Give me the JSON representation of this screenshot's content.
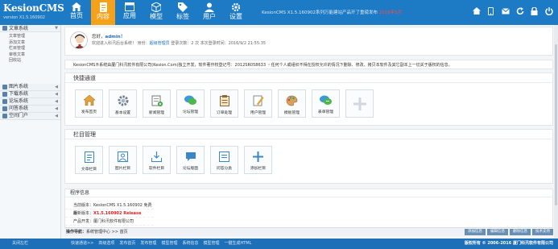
{
  "brand": {
    "name": "KesionCMS",
    "version": "version X1.5.160902"
  },
  "nav": [
    {
      "label": "首页",
      "icon": "home-icon"
    },
    {
      "label": "内容",
      "icon": "document-icon"
    },
    {
      "label": "应用",
      "icon": "window-icon"
    },
    {
      "label": "模型",
      "icon": "cube-icon"
    },
    {
      "label": "标签",
      "icon": "tag-icon"
    },
    {
      "label": "用户",
      "icon": "user-icon"
    },
    {
      "label": "设置",
      "icon": "gear-icon"
    }
  ],
  "notice": {
    "text": "KesionCMS X1.5.160902系列万能建站产品开了重磅发布",
    "highlight": "2016年5月"
  },
  "toolbar_icons": [
    "home-icon",
    "mobile-icon",
    "mail-icon",
    "refresh-icon",
    "lock-icon",
    "power-icon"
  ],
  "sidebar": {
    "sections": [
      {
        "label": "文章系统",
        "items": [
          "文章管理",
          "添加文章",
          "栏目管理",
          "审核文章",
          "回收站"
        ]
      },
      {
        "label": "图片系统",
        "items": []
      },
      {
        "label": "下载系统",
        "items": []
      },
      {
        "label": "论坛系统",
        "items": []
      },
      {
        "label": "问答系统",
        "items": []
      },
      {
        "label": "空间门户",
        "items": []
      }
    ]
  },
  "welcome": {
    "greeting": "您好，",
    "username": "admin！",
    "line2_prefix": "欢迎进入科汛后台系统！ 身份：",
    "role": "超级管理员",
    "line2_suffix": "登录次数：2 次 本次登录时间：2016/9/2 21:55:35"
  },
  "copyright_notice": "KesionCMS®系统由厦门科汛软件有限公司(Kesion.Com)独立开发，软件著作权登记号：2012SR058633 ・任何个人或组织不得在授权允许的情况下删除、修改、拷贝本软件及其它副本上一切关于版权的信息。",
  "quick": {
    "title": "快捷通道",
    "items": [
      {
        "label": "发布首页",
        "icon": "home-icon"
      },
      {
        "label": "基本设置",
        "icon": "gear-icon"
      },
      {
        "label": "新闻管理",
        "icon": "news-icon"
      },
      {
        "label": "论坛管理",
        "icon": "chat-icon"
      },
      {
        "label": "订单处理",
        "icon": "clipboard-icon"
      },
      {
        "label": "用户管理",
        "icon": "user-edit-icon"
      },
      {
        "label": "模板管理",
        "icon": "palette-icon"
      },
      {
        "label": "表单管理",
        "icon": "form-icon"
      }
    ]
  },
  "columns": {
    "title": "栏目管理",
    "items": [
      {
        "label": "文章栏目",
        "icon": "document-icon"
      },
      {
        "label": "图片栏目",
        "icon": "image-icon"
      },
      {
        "label": "软件栏目",
        "icon": "download-icon"
      },
      {
        "label": "论坛版面",
        "icon": "comment-icon"
      },
      {
        "label": "问答分类",
        "icon": "qa-icon"
      },
      {
        "label": "添加栏目",
        "icon": "plus-icon"
      }
    ]
  },
  "program": {
    "title": "程序信息",
    "rows": [
      {
        "label": "当前版本：",
        "value": "KesionCMS X1.5.160902 免费版"
      },
      {
        "label": "最新版本：",
        "value": "X1.5.160902 Release"
      },
      {
        "label": "产品开发：",
        "value": "厦门科汛软件有限公司"
      }
    ]
  },
  "pathbar": {
    "prefix": "操作导航：",
    "path": "系统管理中心 >> 首页",
    "buttons": [
      "添加信息",
      "编辑信息",
      "删除信息",
      "技术支持"
    ]
  },
  "footer": {
    "close": "关闭左栏",
    "links": [
      "快速通道>>",
      "高级选项",
      "发布首页",
      "发布管理",
      "模型管理",
      "系统信息",
      "模型管理",
      "一键生成HTML"
    ],
    "copyright": "版权所有 © 2006-2016 厦门科汛软件有限公司"
  },
  "colors": {
    "header": "#1d7ac4",
    "active_tab": "#f6a11a",
    "footer": "#1d6fb8"
  }
}
